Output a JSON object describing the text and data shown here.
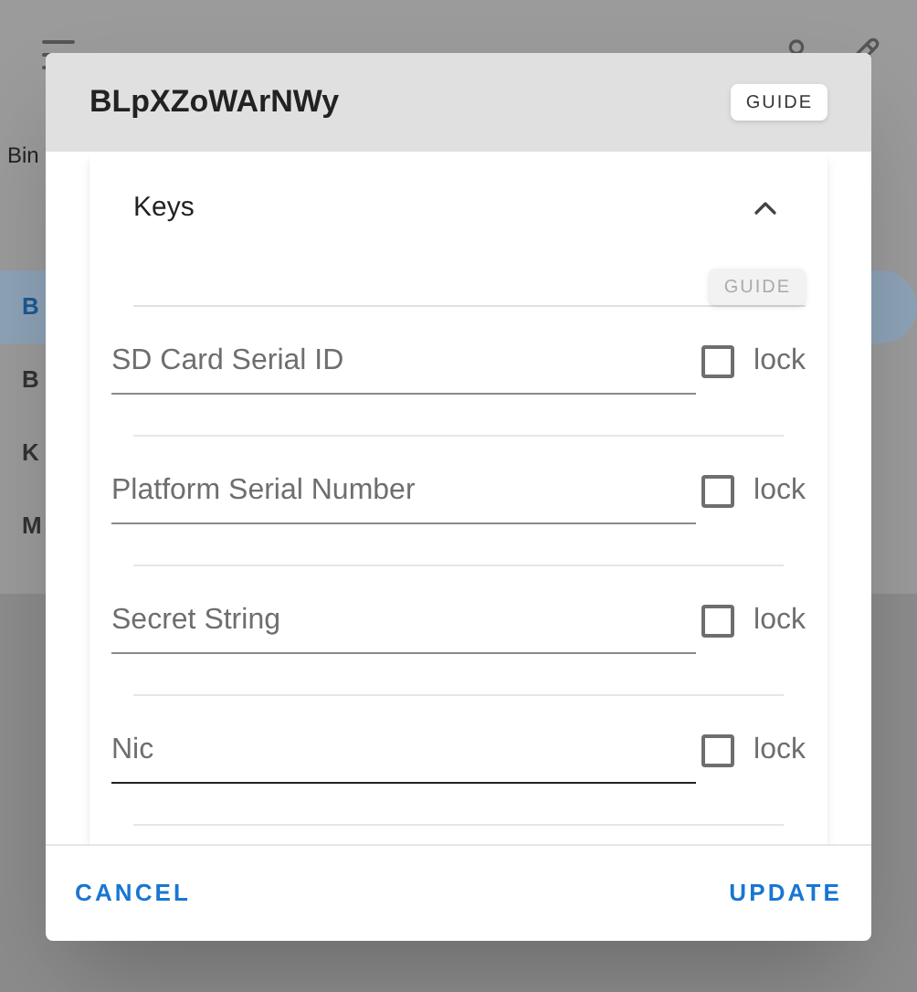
{
  "background": {
    "search_label": "Bin",
    "items": [
      {
        "label": "B",
        "selected": true
      },
      {
        "label": "B",
        "selected": false
      },
      {
        "label": "K",
        "selected": false
      },
      {
        "label": "M",
        "selected": false
      }
    ]
  },
  "dialog": {
    "title": "BLpXZoWArNWy",
    "guide_button": "GUIDE",
    "section": {
      "title": "Keys",
      "expanded": true,
      "guide_button": "GUIDE",
      "guide_disabled": true
    },
    "fields": [
      {
        "label": "SD Card Serial ID",
        "checkbox_label": "lock",
        "checked": false,
        "hovered": false
      },
      {
        "label": "Platform Serial Number",
        "checkbox_label": "lock",
        "checked": false,
        "hovered": false
      },
      {
        "label": "Secret String",
        "checkbox_label": "lock",
        "checked": false,
        "hovered": false
      },
      {
        "label": "Nic",
        "checkbox_label": "lock",
        "checked": false,
        "hovered": true
      }
    ],
    "cancel_button": "CANCEL",
    "update_button": "UPDATE"
  }
}
